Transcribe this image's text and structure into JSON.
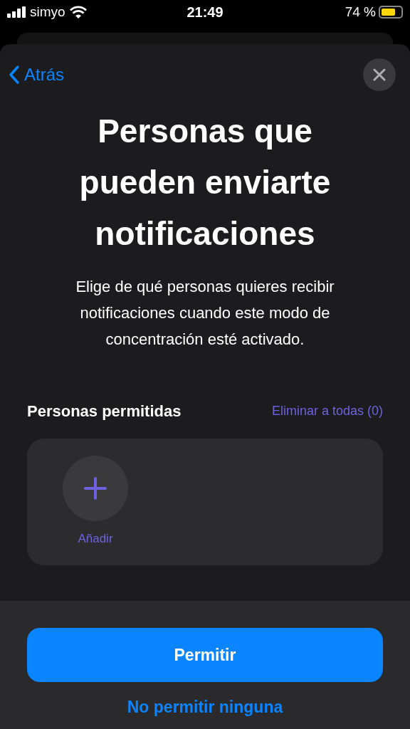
{
  "status_bar": {
    "carrier": "simyo",
    "time": "21:49",
    "battery_text": "74 %"
  },
  "nav": {
    "back": "Atrás"
  },
  "title": "Personas que pueden enviarte notificaciones",
  "description": "Elige de qué personas quieres recibir notificaciones cuando este modo de concentración esté activado.",
  "section": {
    "title": "Personas permitidas",
    "action": "Eliminar a todas (0)",
    "add_label": "Añadir"
  },
  "buttons": {
    "primary": "Permitir",
    "secondary": "No permitir ninguna"
  }
}
